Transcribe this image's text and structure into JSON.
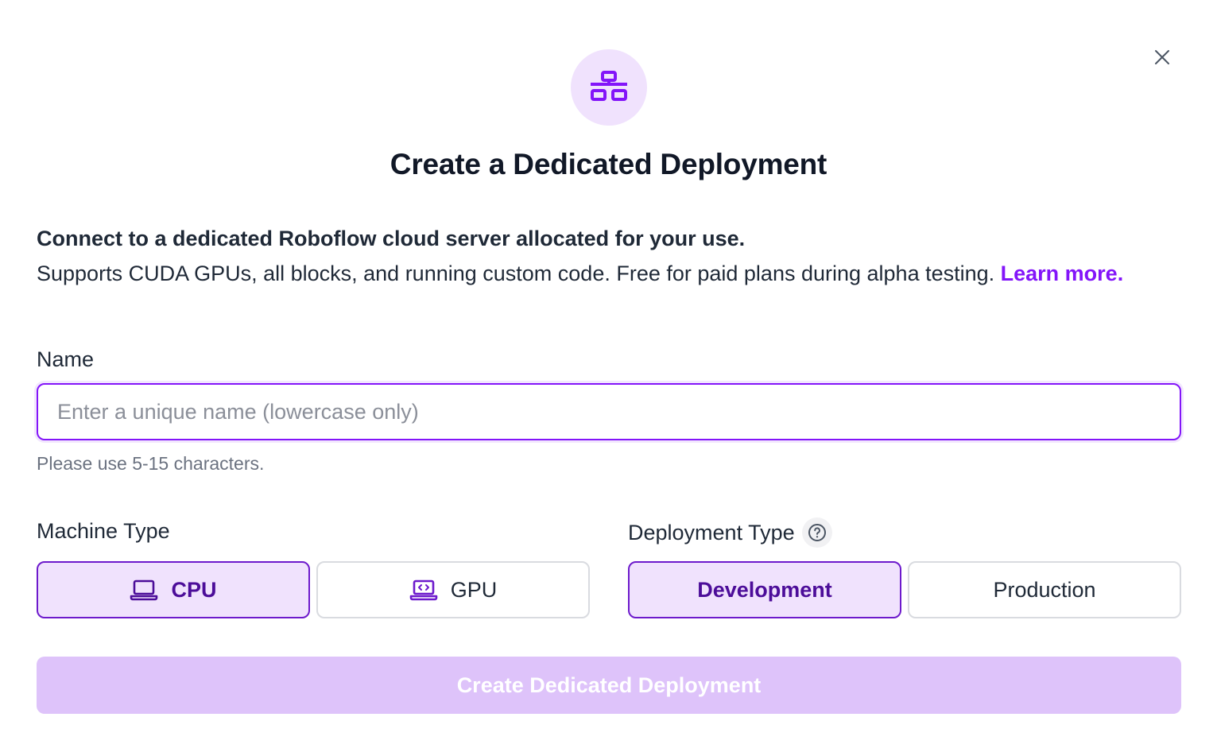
{
  "modal": {
    "title": "Create a Dedicated Deployment",
    "header_icon": "network-icon",
    "close_icon": "close-icon"
  },
  "description": {
    "bold": "Connect to a dedicated Roboflow cloud server allocated for your use.",
    "text": "Supports CUDA GPUs, all blocks, and running custom code. Free for paid plans during alpha testing. ",
    "link": "Learn more."
  },
  "name_field": {
    "label": "Name",
    "value": "",
    "placeholder": "Enter a unique name (lowercase only)",
    "hint": "Please use 5-15 characters."
  },
  "machine_type": {
    "label": "Machine Type",
    "options": [
      {
        "label": "CPU",
        "icon": "laptop-icon",
        "selected": true
      },
      {
        "label": "GPU",
        "icon": "gpu-laptop-icon",
        "selected": false
      }
    ]
  },
  "deployment_type": {
    "label": "Deployment Type",
    "help_icon": "help-icon",
    "options": [
      {
        "label": "Development",
        "selected": true
      },
      {
        "label": "Production",
        "selected": false
      }
    ]
  },
  "submit": {
    "label": "Create Dedicated Deployment",
    "disabled": true
  },
  "colors": {
    "accent": "#8315f9",
    "selected_bg": "#f0e2fd",
    "selected_border": "#6d1acc",
    "disabled_button": "#dec3fa"
  }
}
